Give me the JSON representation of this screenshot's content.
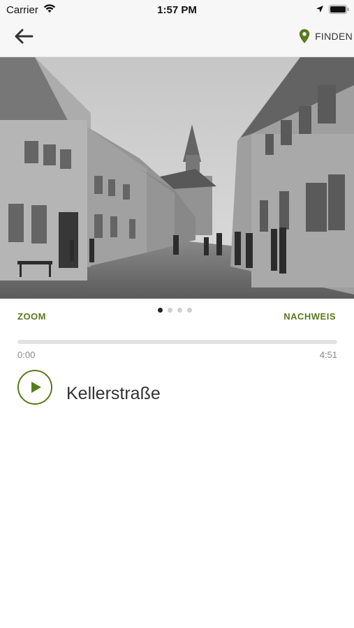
{
  "status": {
    "carrier": "Carrier",
    "time": "1:57 PM"
  },
  "nav": {
    "back_icon": "arrow-left-icon",
    "finden_label": "FINDEN",
    "finden_icon": "map-pin-icon",
    "accent": "#5a7a1e"
  },
  "photo": {
    "description_icon": "historic-street-photo"
  },
  "gallery": {
    "zoom_label": "ZOOM",
    "credit_label": "NACHWEIS",
    "page_count": 4,
    "active_page": 1
  },
  "player": {
    "elapsed": "0:00",
    "duration": "4:51",
    "progress": 0,
    "title": "Kellerstraße",
    "play_icon": "play-icon"
  }
}
